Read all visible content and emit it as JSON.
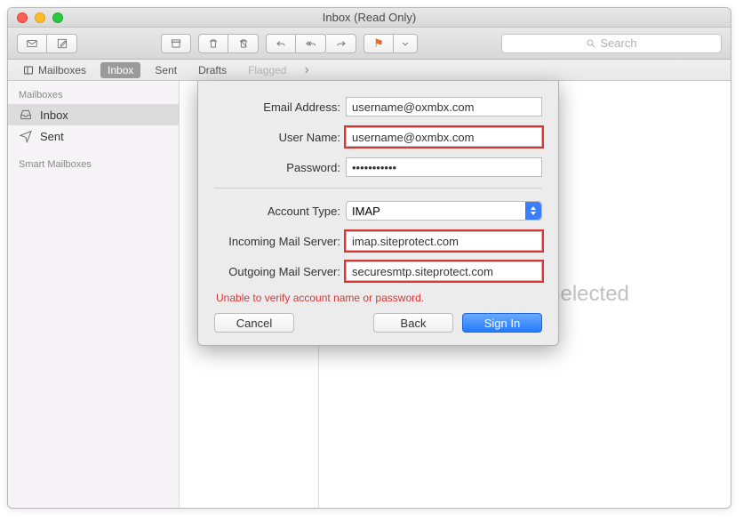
{
  "window": {
    "title": "Inbox (Read Only)"
  },
  "search": {
    "placeholder": "Search"
  },
  "tabbar": {
    "mailboxes": "Mailboxes",
    "items": [
      "Inbox",
      "Sent",
      "Drafts",
      "Flagged"
    ],
    "active_index": 0,
    "disabled_index": 3
  },
  "sidebar": {
    "header_mailboxes": "Mailboxes",
    "inbox_label": "Inbox",
    "sent_label": "Sent",
    "header_smart": "Smart Mailboxes"
  },
  "preview": {
    "empty_text": "No Message Selected"
  },
  "sheet": {
    "labels": {
      "email": "Email Address:",
      "user": "User Name:",
      "password": "Password:",
      "account_type": "Account Type:",
      "incoming": "Incoming Mail Server:",
      "outgoing": "Outgoing Mail Server:"
    },
    "values": {
      "email": "username@oxmbx.com",
      "user": "username@oxmbx.com",
      "password": "•••••••••••",
      "account_type": "IMAP",
      "incoming": "imap.siteprotect.com",
      "outgoing": "securesmtp.siteprotect.com"
    },
    "error": "Unable to verify account name or password.",
    "buttons": {
      "cancel": "Cancel",
      "back": "Back",
      "signin": "Sign In"
    }
  }
}
